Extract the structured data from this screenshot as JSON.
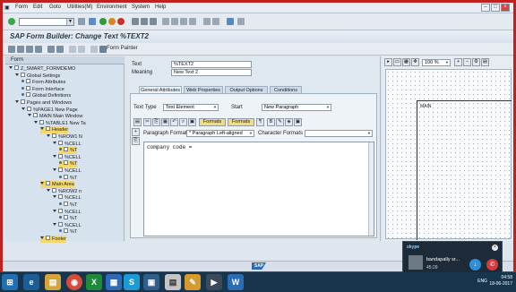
{
  "menu": {
    "items": [
      "Form",
      "Edit",
      "Goto",
      "Utilities(M)",
      "Environment",
      "System",
      "Help"
    ]
  },
  "window_title": "SAP Form Builder: Change Text %TEXT2",
  "toolbar2": {
    "form_painter": "Form Painter"
  },
  "tree": {
    "header": "Form",
    "rows": [
      {
        "label": "Z_SMART_FORMDEMO",
        "indent": 0,
        "kind": "form"
      },
      {
        "label": "Global Settings",
        "indent": 1,
        "kind": "folder"
      },
      {
        "label": "Form Attributes",
        "indent": 2,
        "kind": "leaf"
      },
      {
        "label": "Form Interface",
        "indent": 2,
        "kind": "leaf"
      },
      {
        "label": "Global Definitions",
        "indent": 2,
        "kind": "leaf"
      },
      {
        "label": "Pages and Windows",
        "indent": 1,
        "kind": "folder"
      },
      {
        "label": "%PAGE1 New Page",
        "indent": 2,
        "kind": "folder"
      },
      {
        "label": "MAIN Main Window",
        "indent": 3,
        "kind": "folder"
      },
      {
        "label": "%TABLE1 New Ta",
        "indent": 4,
        "kind": "folder"
      },
      {
        "label": "Header",
        "indent": 5,
        "kind": "folder",
        "highlight": true
      },
      {
        "label": "%ROW1 N",
        "indent": 6,
        "kind": "folder"
      },
      {
        "label": "%CELL",
        "indent": 7,
        "kind": "folder"
      },
      {
        "label": "%T",
        "indent": 8,
        "kind": "leaf",
        "highlight": true
      },
      {
        "label": "%CELL",
        "indent": 7,
        "kind": "folder"
      },
      {
        "label": "%T",
        "indent": 8,
        "kind": "leaf",
        "highlight": true
      },
      {
        "label": "%CELL",
        "indent": 7,
        "kind": "folder"
      },
      {
        "label": "%T",
        "indent": 8,
        "kind": "leaf"
      },
      {
        "label": "Main Area",
        "indent": 5,
        "kind": "folder",
        "highlight": true
      },
      {
        "label": "%ROW2 n",
        "indent": 6,
        "kind": "folder"
      },
      {
        "label": "%CELL",
        "indent": 7,
        "kind": "folder"
      },
      {
        "label": "%T",
        "indent": 8,
        "kind": "leaf"
      },
      {
        "label": "%CELL",
        "indent": 7,
        "kind": "folder"
      },
      {
        "label": "%T",
        "indent": 8,
        "kind": "leaf"
      },
      {
        "label": "%CELL",
        "indent": 7,
        "kind": "folder"
      },
      {
        "label": "%T",
        "indent": 8,
        "kind": "leaf"
      },
      {
        "label": "Footer",
        "indent": 5,
        "kind": "folder",
        "highlight": true
      }
    ]
  },
  "detail": {
    "text_label": "Text",
    "text_value": "%TEXT2",
    "meaning_label": "Meaning",
    "meaning_value": "New Text 2",
    "tabs": [
      "General Attributes",
      "Web Properties",
      "Output Options",
      "Conditions"
    ],
    "text_type_label": "Text Type",
    "text_type_value": "Text Element",
    "start_label": "Start",
    "start_value": "New Paragraph",
    "formats_btn": "Formats",
    "formats_btn2": "Formats",
    "paragraph_formats_label": "Paragraph Formats",
    "paragraph_formats_value": "* Paragraph Left-aligned",
    "character_formats_label": "Character Formats",
    "character_formats_value": "",
    "editor_text": "company code ="
  },
  "painter": {
    "zoom": "100 %",
    "window_label": "MAIN"
  },
  "skype": {
    "brand": "skype",
    "caller": "bandapally sr...",
    "duration": "45:29"
  },
  "tray": {
    "lang": "ENG",
    "time": "04:58",
    "date": "18-06-2017"
  },
  "statusbar": {
    "logo": "SAP"
  }
}
